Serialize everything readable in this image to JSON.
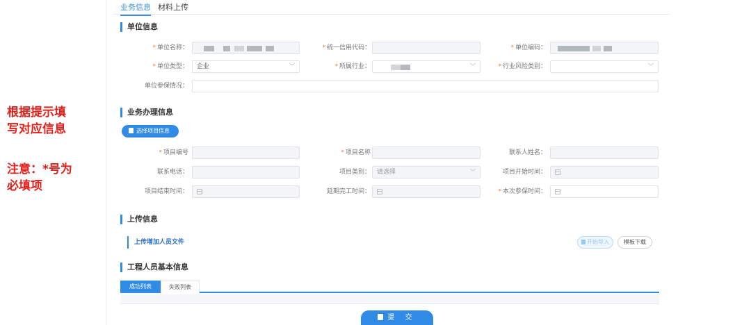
{
  "annotation": {
    "line1": "根据提示填",
    "line2": "写对应信息",
    "line3": "注意：*号为",
    "line4": "必填项"
  },
  "top_tabs": {
    "active": "业务信息",
    "inactive": "材料上传"
  },
  "unit_section": {
    "title": "单位信息",
    "unit_name_label": "单位名称：",
    "credit_code_label": "统一信用代码：",
    "unit_code_label": "单位编码：",
    "unit_type_label": "单位类型：",
    "unit_type_value": "企业",
    "industry_label": "所属行业：",
    "risk_label": "行业风险类别：",
    "insurance_label": "单位参保情况："
  },
  "business_section": {
    "title": "业务办理信息",
    "select_button": "选择项目信息",
    "project_no_label": "项目编号",
    "project_name_label": "项目名称",
    "contact_name_label": "联系人姓名：",
    "phone_label": "联系电话：",
    "project_type_label": "项目类别：",
    "project_type_placeholder": "请选择",
    "project_start_label": "项目开始时间：",
    "project_end_label": "项目结束时间：",
    "delay_label": "延期完工时间：",
    "insure_time_label": "本次参保时间："
  },
  "upload_section": {
    "title": "上传信息",
    "file_label": "上传增加人员文件",
    "import_button": "开始导入",
    "template_button": "模板下载"
  },
  "staff_section": {
    "title": "工程人员基本信息",
    "tab_success": "成功列表",
    "tab_fail": "失败列表"
  },
  "submit_label": "提 交",
  "colors": {
    "accent": "#2f8be6",
    "annotation": "#e0201a",
    "required": "#f07a3a"
  }
}
